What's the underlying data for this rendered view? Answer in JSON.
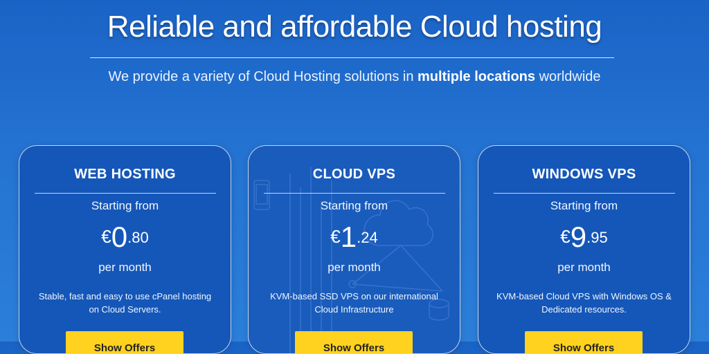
{
  "hero": {
    "title": "Reliable and affordable Cloud hosting",
    "subtitle_pre": "We provide a variety of Cloud Hosting solutions in ",
    "subtitle_bold": "multiple locations",
    "subtitle_post": " worldwide"
  },
  "plans": [
    {
      "title": "WEB HOSTING",
      "starting_label": "Starting from",
      "currency": "€",
      "price_int": "0",
      "price_dec": ".80",
      "period": "per month",
      "description": "Stable, fast and easy to use cPanel hosting on Cloud Servers.",
      "button_label": "Show Offers"
    },
    {
      "title": "CLOUD VPS",
      "starting_label": "Starting from",
      "currency": "€",
      "price_int": "1",
      "price_dec": ".24",
      "period": "per month",
      "description": "KVM-based SSD VPS on our international Cloud Infrastructure",
      "button_label": "Show Offers"
    },
    {
      "title": "WINDOWS VPS",
      "starting_label": "Starting from",
      "currency": "€",
      "price_int": "9",
      "price_dec": ".95",
      "period": "per month",
      "description": "KVM-based Cloud VPS with Windows OS & Dedicated resources.",
      "button_label": "Show Offers"
    }
  ],
  "colors": {
    "background": "#2473d2",
    "card": "#1557b8",
    "button": "#ffd21f"
  }
}
